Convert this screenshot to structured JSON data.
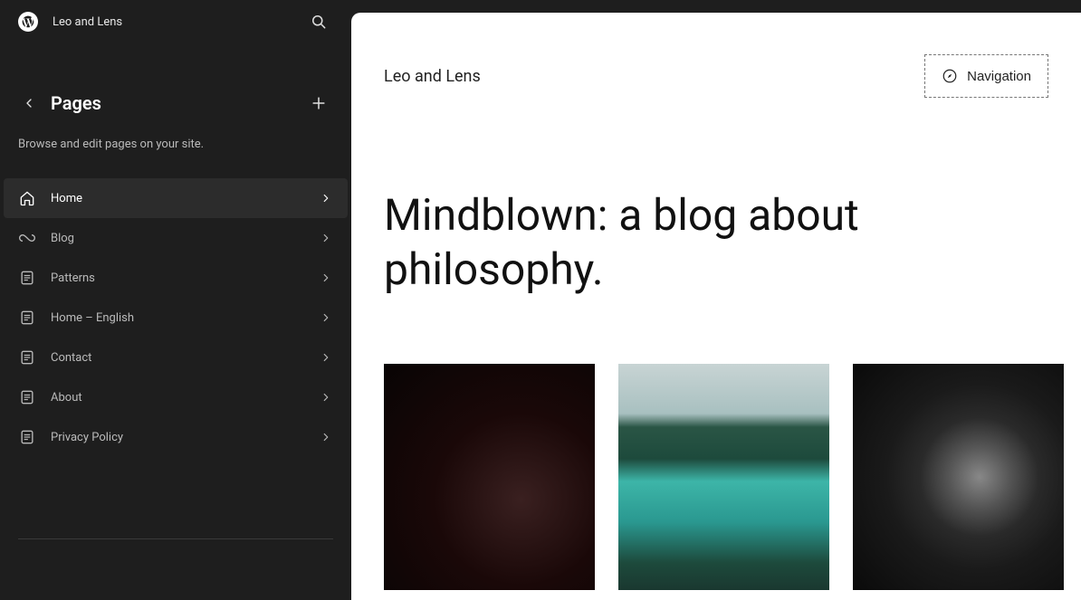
{
  "site_name": "Leo and Lens",
  "sidebar": {
    "title": "Pages",
    "description": "Browse and edit pages on your site.",
    "items": [
      {
        "label": "Home",
        "icon": "home",
        "active": true
      },
      {
        "label": "Blog",
        "icon": "loop",
        "active": false
      },
      {
        "label": "Patterns",
        "icon": "page",
        "active": false
      },
      {
        "label": "Home – English",
        "icon": "page",
        "active": false
      },
      {
        "label": "Contact",
        "icon": "page",
        "active": false
      },
      {
        "label": "About",
        "icon": "page",
        "active": false
      },
      {
        "label": "Privacy Policy",
        "icon": "page",
        "active": false
      }
    ]
  },
  "content": {
    "site_name": "Leo and Lens",
    "nav_button": "Navigation",
    "headline": "Mindblown: a blog about philosophy.",
    "gallery": [
      {
        "name": "camera-image"
      },
      {
        "name": "mountain-lake-image"
      },
      {
        "name": "car-interior-image"
      }
    ]
  }
}
